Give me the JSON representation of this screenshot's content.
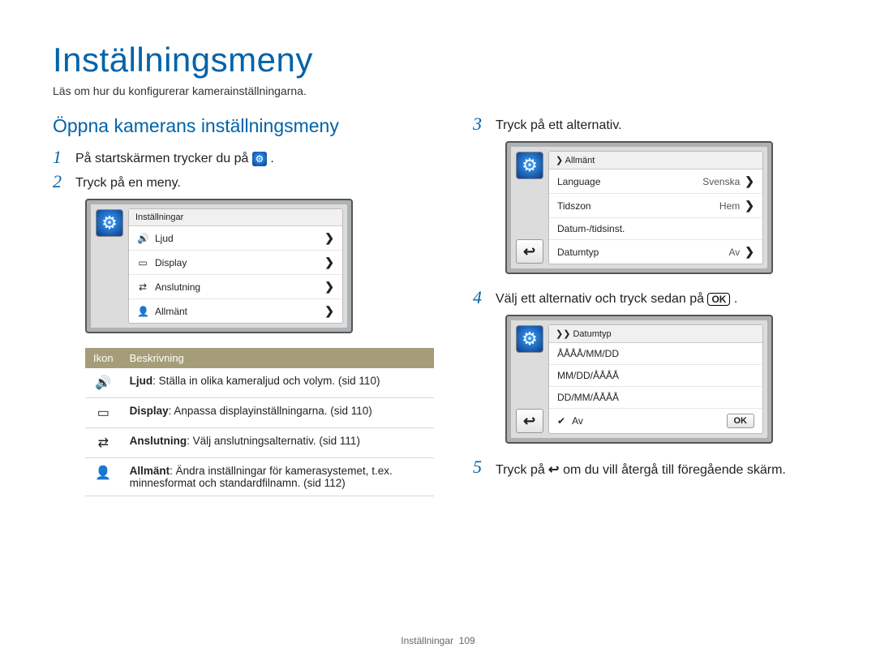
{
  "title": "Inställningsmeny",
  "subtitle": "Läs om hur du konfigurerar kamerainställningarna.",
  "section_heading": "Öppna kamerans inställningsmeny",
  "steps": {
    "s1_pre": "På startskärmen trycker du på ",
    "s1_post": ".",
    "s2": "Tryck på en meny.",
    "s3": "Tryck på ett alternativ.",
    "s4_pre": "Välj ett alternativ och tryck sedan på ",
    "s4_ok": "OK",
    "s4_post": ".",
    "s5_pre": "Tryck på ",
    "s5_sym": "↩",
    "s5_post": " om du vill återgå till föregående skärm."
  },
  "screen1": {
    "header": "Inställningar",
    "rows": [
      {
        "icon": "🔊",
        "label": "Ljud"
      },
      {
        "icon": "▭",
        "label": "Display"
      },
      {
        "icon": "⇄",
        "label": "Anslutning"
      },
      {
        "icon": "👤",
        "label": "Allmänt"
      }
    ]
  },
  "screen2": {
    "crumb": "❯ Allmänt",
    "rows": [
      {
        "label": "Language",
        "value": "Svenska",
        "chev": true
      },
      {
        "label": "Tidszon",
        "value": "Hem",
        "chev": true
      },
      {
        "label": "Datum-/tidsinst.",
        "value": "",
        "chev": false
      },
      {
        "label": "Datumtyp",
        "value": "Av",
        "chev": true
      }
    ]
  },
  "screen3": {
    "crumb": "❯❯ Datumtyp",
    "options": [
      "ÅÅÅÅ/MM/DD",
      "MM/DD/ÅÅÅÅ",
      "DD/MM/ÅÅÅÅ"
    ],
    "selected": "Av",
    "ok": "OK"
  },
  "icon_table": {
    "head_icon": "Ikon",
    "head_desc": "Beskrivning",
    "rows": [
      {
        "icon": "🔊",
        "bold": "Ljud",
        "text": ": Ställa in olika kameraljud och volym. (sid 110)"
      },
      {
        "icon": "▭",
        "bold": "Display",
        "text": ": Anpassa displayinställningarna. (sid 110)"
      },
      {
        "icon": "⇄",
        "bold": "Anslutning",
        "text": ": Välj anslutningsalternativ. (sid 111)"
      },
      {
        "icon": "👤",
        "bold": "Allmänt",
        "text": ": Ändra inställningar för kamerasystemet, t.ex. minnesformat och standardfilnamn. (sid 112)"
      }
    ]
  },
  "footer": {
    "label": "Inställningar",
    "page": "109"
  }
}
